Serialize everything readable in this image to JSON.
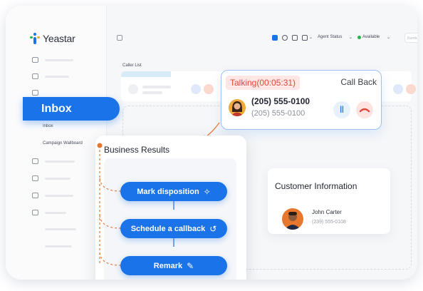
{
  "brand": {
    "name": "Yeastar",
    "color": "#1a73e8",
    "accent": "#e8772e"
  },
  "topbar": {
    "agent_status": "Agent Status",
    "available": "Available",
    "number_placeholder": "Number"
  },
  "sidebar": {
    "inbox_label": "Inbox",
    "sub_items": [
      "Inbox",
      "Campaign Wallboard"
    ]
  },
  "caller_list": {
    "title": "Caller List"
  },
  "call": {
    "status": "Talking(00:05:31)",
    "callback_label": "Call Back",
    "number": "(205) 555-0100",
    "number_secondary": "(205) 555-0100",
    "pause_icon": "pause-icon",
    "hangup_icon": "hangup-icon"
  },
  "business_results": {
    "title": "Business Results",
    "actions": [
      {
        "label": "Mark disposition",
        "icon": "pin-icon",
        "glyph": "✧"
      },
      {
        "label": "Schedule a callback",
        "icon": "callback-icon",
        "glyph": "↺"
      },
      {
        "label": "Remark",
        "icon": "pencil-icon",
        "glyph": "✎"
      }
    ]
  },
  "customer": {
    "title": "Customer Information",
    "name": "John Carter",
    "phone": "(239) 555-0108"
  }
}
